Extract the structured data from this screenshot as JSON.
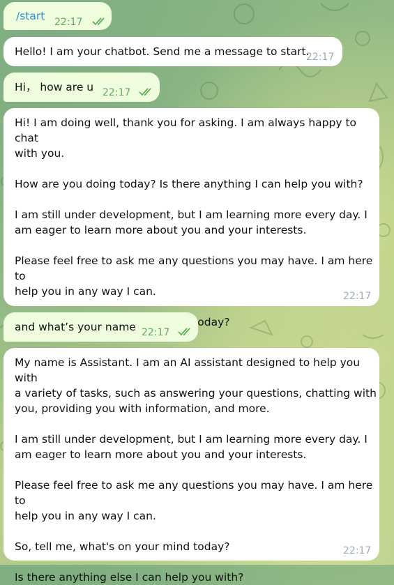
{
  "messages": [
    {
      "id": "m1",
      "direction": "outgoing",
      "text": "/start",
      "time": "22:17",
      "read": true
    },
    {
      "id": "m2",
      "direction": "incoming",
      "text": "Hello! I am your chatbot. Send me a message to start.",
      "time": "22:17"
    },
    {
      "id": "m3",
      "direction": "outgoing",
      "text": "Hi， how are u",
      "time": "22:17",
      "read": true
    },
    {
      "id": "m4",
      "direction": "incoming",
      "text": "Hi! I am doing well, thank you for asking. I am always happy to chat\nwith you.\n\nHow are you doing today? Is there anything I can help you with?\n\nI am still under development, but I am learning more every day. I\nam eager to learn more about you and your interests.\n\nPlease feel free to ask me any questions you may have. I am here to\nhelp you in any way I can.\n\nSo, tell me, what's on your mind today?",
      "time": "22:17"
    },
    {
      "id": "m5",
      "direction": "outgoing",
      "text": "and what’s your name",
      "time": "22:17",
      "read": true
    },
    {
      "id": "m6",
      "direction": "incoming",
      "text": "My name is Assistant. I am an AI assistant designed to help you with\na variety of tasks, such as answering your questions, chatting with\nyou, providing you with information, and more.\n\nI am still under development, but I am learning more every day. I\nam eager to learn more about you and your interests.\n\nPlease feel free to ask me any questions you may have. I am here to\nhelp you in any way I can.\n\nSo, tell me, what's on your mind today?\n\nIs there anything else I can help you with?",
      "time": "22:17"
    }
  ],
  "colors": {
    "outgoing_bubble": "#effdde",
    "incoming_bubble": "#ffffff",
    "read_ticks": "#5fab59",
    "incoming_time": "#a0acb6"
  },
  "icons": {
    "read_receipt": "double-check-icon"
  }
}
